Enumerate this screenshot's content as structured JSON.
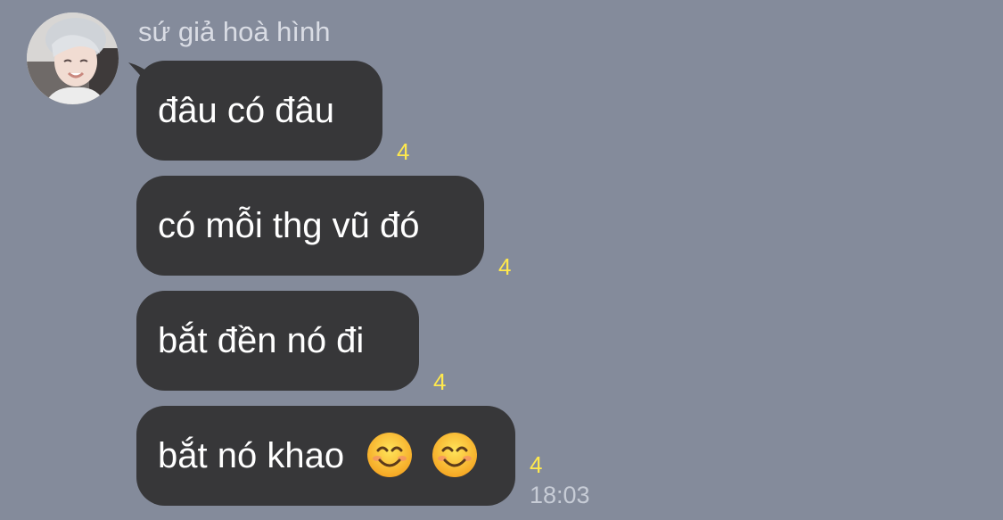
{
  "chat": {
    "sender_name": "sứ giả hoà hình",
    "messages": [
      {
        "text": "đâu có đâu",
        "unread_count": "4"
      },
      {
        "text": "có mỗi thg vũ đó",
        "unread_count": "4"
      },
      {
        "text": "bắt đền nó đi",
        "unread_count": "4"
      },
      {
        "text": "bắt nó khao",
        "emoji_count": 2,
        "emoji": "smiling-face-icon",
        "unread_count": "4",
        "time": "18:03"
      }
    ]
  },
  "colors": {
    "background": "#848b9b",
    "bubble": "#373739",
    "message_text": "#ffffff",
    "unread_count": "#ffe94d",
    "sender_name": "#d9dce4",
    "timestamp": "#c7ccd6"
  }
}
